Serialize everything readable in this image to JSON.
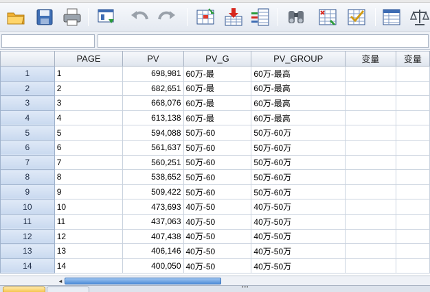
{
  "toolbar": {
    "buttons": [
      {
        "name": "open-folder-icon"
      },
      {
        "name": "save-icon"
      },
      {
        "name": "print-icon"
      },
      {
        "name": "recall-dialog-icon"
      },
      {
        "name": "undo-icon"
      },
      {
        "name": "redo-icon"
      },
      {
        "name": "go-to-case-icon"
      },
      {
        "name": "insert-cases-icon"
      },
      {
        "name": "variables-icon"
      },
      {
        "name": "find-icon"
      },
      {
        "name": "split-file-icon"
      },
      {
        "name": "select-cases-icon"
      },
      {
        "name": "value-labels-icon"
      },
      {
        "name": "weight-cases-icon"
      }
    ]
  },
  "editor": {
    "cell_name": "",
    "cell_value": ""
  },
  "columns": [
    "PAGE",
    "PV",
    "PV_G",
    "PV_GROUP",
    "变量",
    "变量"
  ],
  "rows": [
    {
      "n": "1",
      "page": "1",
      "pv": "698,981",
      "pv_g": "60万-最",
      "pv_group": "60万-最高"
    },
    {
      "n": "2",
      "page": "2",
      "pv": "682,651",
      "pv_g": "60万-最",
      "pv_group": "60万-最高"
    },
    {
      "n": "3",
      "page": "3",
      "pv": "668,076",
      "pv_g": "60万-最",
      "pv_group": "60万-最高"
    },
    {
      "n": "4",
      "page": "4",
      "pv": "613,138",
      "pv_g": "60万-最",
      "pv_group": "60万-最高"
    },
    {
      "n": "5",
      "page": "5",
      "pv": "594,088",
      "pv_g": "50万-60",
      "pv_group": "50万-60万"
    },
    {
      "n": "6",
      "page": "6",
      "pv": "561,637",
      "pv_g": "50万-60",
      "pv_group": "50万-60万"
    },
    {
      "n": "7",
      "page": "7",
      "pv": "560,251",
      "pv_g": "50万-60",
      "pv_group": "50万-60万"
    },
    {
      "n": "8",
      "page": "8",
      "pv": "538,652",
      "pv_g": "50万-60",
      "pv_group": "50万-60万"
    },
    {
      "n": "9",
      "page": "9",
      "pv": "509,422",
      "pv_g": "50万-60",
      "pv_group": "50万-60万"
    },
    {
      "n": "10",
      "page": "10",
      "pv": "473,693",
      "pv_g": "40万-50",
      "pv_group": "40万-50万"
    },
    {
      "n": "11",
      "page": "11",
      "pv": "437,063",
      "pv_g": "40万-50",
      "pv_group": "40万-50万"
    },
    {
      "n": "12",
      "page": "12",
      "pv": "407,438",
      "pv_g": "40万-50",
      "pv_group": "40万-50万"
    },
    {
      "n": "13",
      "page": "13",
      "pv": "406,146",
      "pv_g": "40万-50",
      "pv_group": "40万-50万"
    },
    {
      "n": "14",
      "page": "14",
      "pv": "400,050",
      "pv_g": "40万-50",
      "pv_group": "40万-50万"
    }
  ],
  "scrollbar": {
    "left_arrow": "◂"
  },
  "colors": {
    "row_header": "#cfdcf0",
    "toolbar_bg": "#e9edf3",
    "scroll_thumb": "#4f8ed8"
  }
}
